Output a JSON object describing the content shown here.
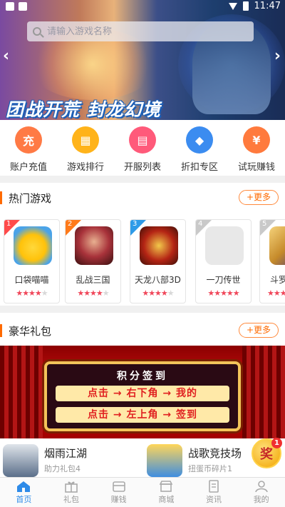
{
  "status_bar": {
    "time": "11:47"
  },
  "search": {
    "placeholder": "请输入游戏名称"
  },
  "banner": {
    "caption": "团战开荒 封龙幻境",
    "prev_arrow": "‹",
    "next_arrow": "›"
  },
  "quick_menu": [
    {
      "label": "账户充值",
      "glyph": "充",
      "color": "#ff7a45",
      "icon": "recharge-icon"
    },
    {
      "label": "游戏排行",
      "glyph": "▦",
      "color": "#ffb31a",
      "icon": "ranking-icon"
    },
    {
      "label": "开服列表",
      "glyph": "▤",
      "color": "#ff5a7a",
      "icon": "server-list-icon"
    },
    {
      "label": "折扣专区",
      "glyph": "◆",
      "color": "#3b8cf0",
      "icon": "discount-tag-icon"
    },
    {
      "label": "试玩赚钱",
      "glyph": "¥",
      "color": "#ff7a3d",
      "icon": "trial-earn-icon"
    }
  ],
  "hot_games": {
    "title": "热门游戏",
    "more": "+更多",
    "items": [
      {
        "rank": "1",
        "name": "口袋喵喵",
        "rating": 4,
        "rank_color": "#ff4b4b",
        "icon_color": "#ffd83b"
      },
      {
        "rank": "2",
        "name": "乱战三国",
        "rating": 4,
        "rank_color": "#ff7a1a",
        "icon_color": "#a8323a"
      },
      {
        "rank": "3",
        "name": "天龙八部3D",
        "rating": 4,
        "rank_color": "#2e9be8",
        "icon_color": "#b42414"
      },
      {
        "rank": "4",
        "name": "一刀传世",
        "rating": 5,
        "rank_color": "#c9c9c9",
        "icon_color": "#e8e8e8"
      },
      {
        "rank": "5",
        "name": "斗罗",
        "rating": 4,
        "rank_color": "#c9c9c9",
        "icon_color": "#c58a2a"
      }
    ]
  },
  "gift_section": {
    "title": "豪华礼包",
    "more": "+更多",
    "banner_title": "积分签到",
    "banner_line1": "点击 → 右下角 → 我的",
    "banner_line2": "点击 → 左上角 → 签到"
  },
  "gift_list": [
    {
      "name": "烟雨江湖",
      "sub": "助力礼包4",
      "icon_color": "#5b6f8a"
    },
    {
      "name": "战歌竞技场",
      "sub": "扭蛋币碎片1",
      "icon_color": "#3f8ee0"
    }
  ],
  "floating_badge": {
    "label": "奖",
    "count": "1"
  },
  "tabbar": [
    {
      "label": "首页",
      "icon": "home-icon",
      "active": true
    },
    {
      "label": "礼包",
      "icon": "gift-icon",
      "active": false
    },
    {
      "label": "赚钱",
      "icon": "earn-icon",
      "active": false
    },
    {
      "label": "商城",
      "icon": "store-icon",
      "active": false
    },
    {
      "label": "资讯",
      "icon": "news-icon",
      "active": false
    },
    {
      "label": "我的",
      "icon": "profile-icon",
      "active": false
    }
  ]
}
